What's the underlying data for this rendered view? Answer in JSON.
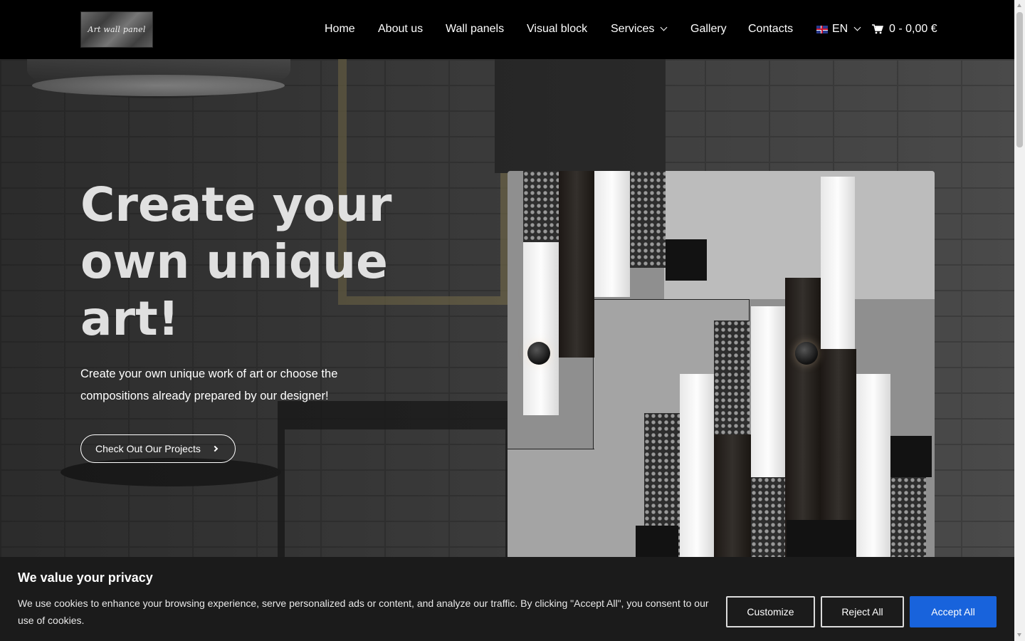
{
  "header": {
    "logo_text": "Art wall panel",
    "nav": {
      "home": "Home",
      "about": "About us",
      "wall_panels": "Wall panels",
      "visual_block": "Visual block",
      "services": "Services",
      "gallery": "Gallery",
      "contacts": "Contacts",
      "language": "EN",
      "cart": "0 - 0,00 €"
    }
  },
  "hero": {
    "title": "Create your own unique art!",
    "subtitle": "Create your own unique work of art or choose the compositions already prepared by our designer!",
    "cta_label": "Check Out Our Projects"
  },
  "cookie_banner": {
    "title": "We value your privacy",
    "text": "We use cookies to enhance your browsing experience, serve personalized ads or content, and analyze our traffic. By clicking \"Accept All\", you consent to our use of cookies.",
    "customize_label": "Customize",
    "reject_label": "Reject All",
    "accept_label": "Accept All"
  },
  "icons": {
    "language_flag": "uk-flag-icon",
    "cart": "cart-icon",
    "dropdown": "chevron-down-icon",
    "cta_arrow": "chevron-right-icon"
  },
  "colors": {
    "header_bg": "#000000",
    "accept_button": "#1863dc",
    "cookie_bg": "#1b1b1b"
  }
}
